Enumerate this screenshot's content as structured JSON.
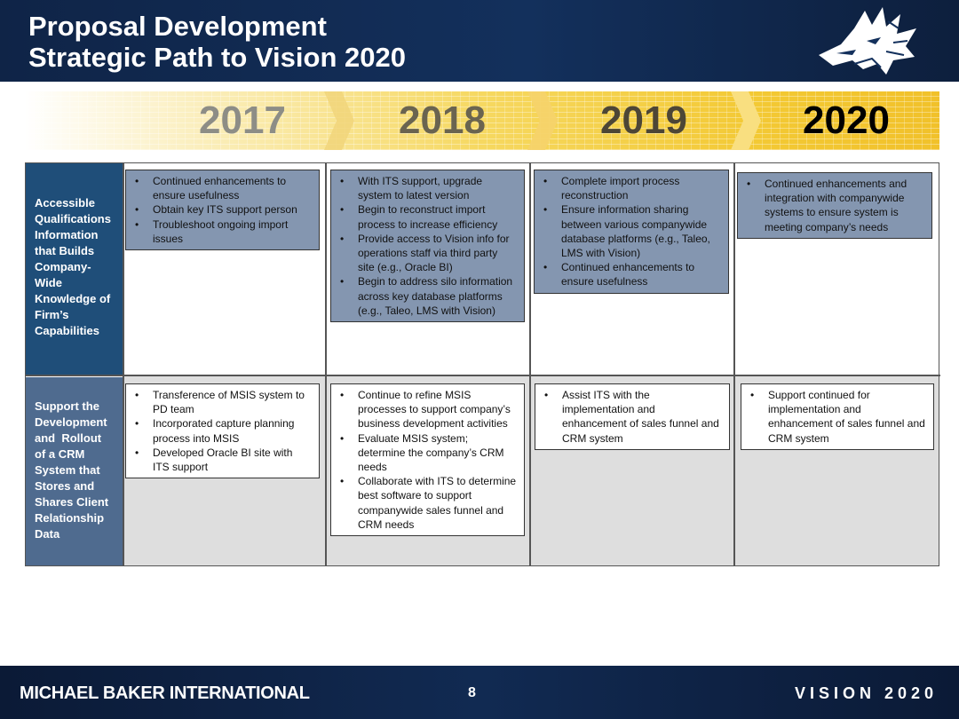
{
  "header": {
    "title_line1": "Proposal Development",
    "title_line2": "Strategic Path to Vision 2020",
    "logo_icon": "wolf-head-icon"
  },
  "years": [
    "2017",
    "2018",
    "2019",
    "2020"
  ],
  "rows": [
    {
      "label": "Accessible Qualifications Information that Builds Company-Wide Knowledge of Firm’s Capabilities",
      "label_lines": [
        "Accessible",
        "Qualifications",
        "Information",
        "that Builds",
        "Company-",
        "Wide",
        "Knowledge of",
        "Firm’s",
        "Capabilities"
      ],
      "cells": [
        [
          "Continued enhancements to ensure usefulness",
          "Obtain key ITS support person",
          "Troubleshoot ongoing import issues"
        ],
        [
          "With ITS support, upgrade system to latest version",
          "Begin to reconstruct import process to increase efficiency",
          "Provide access to Vision info for operations staff via third party site (e.g., Oracle BI)",
          "Begin to address silo information across key database platforms (e.g., Taleo, LMS with Vision)"
        ],
        [
          "Complete import process reconstruction",
          "Ensure information sharing between various companywide database platforms (e.g., Taleo, LMS with Vision)",
          "Continued enhancements to ensure usefulness"
        ],
        [
          "Continued enhancements and integration with companywide systems to ensure system is meeting company’s needs"
        ]
      ]
    },
    {
      "label": "Support the Development and Rollout of a CRM System that Stores and Shares Client Relationship Data",
      "label_lines": [
        "Support the",
        "Development",
        "and  Rollout",
        "of a CRM",
        "System that",
        "Stores and",
        "Shares Client",
        "Relationship",
        "Data"
      ],
      "cells": [
        [
          "Transference of MSIS system to PD team",
          "Incorporated capture planning process into MSIS",
          "Developed Oracle BI site with ITS support"
        ],
        [
          "Continue to refine MSIS processes to support company’s business development activities",
          "Evaluate MSIS system; determine the company’s CRM needs",
          "Collaborate with ITS to determine best software to support companywide sales funnel and CRM needs"
        ],
        [
          "Assist ITS with the implementation and enhancement of sales funnel and CRM system"
        ],
        [
          "Support continued for implementation and enhancement of sales funnel and CRM system"
        ]
      ]
    }
  ],
  "footer": {
    "company": "MICHAEL BAKER INTERNATIONAL",
    "page_number": "8",
    "vision": "VISION 2020"
  },
  "colors": {
    "header_bg": "#13305c",
    "row1_header": "#1f4e79",
    "row2_header": "#4f6b8f",
    "dark_box": "#8496b0",
    "row2_cell_bg": "#dedede",
    "banner_gold": "#f3c934"
  }
}
